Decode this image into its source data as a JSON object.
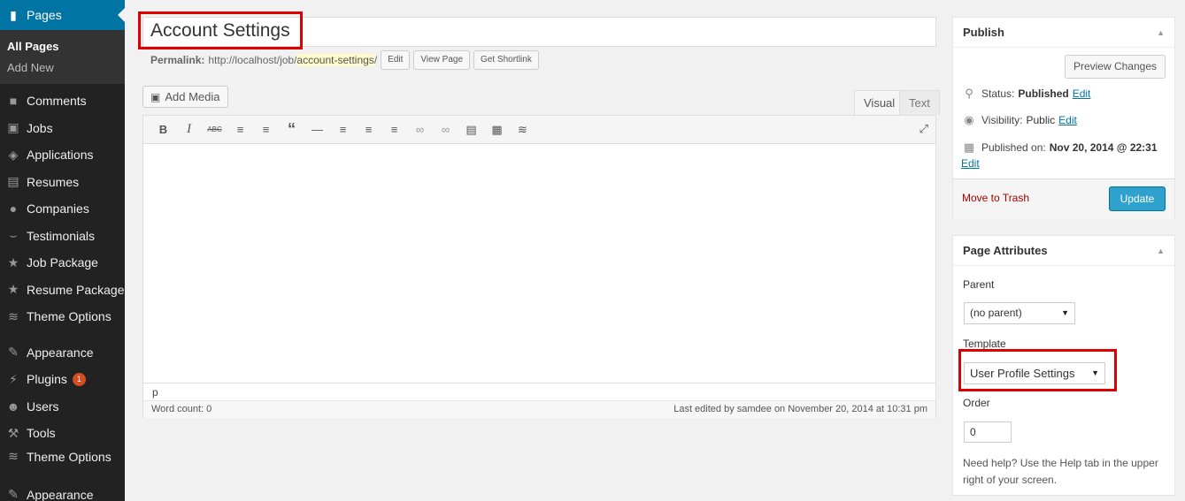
{
  "sidebar": {
    "current": {
      "label": "Pages",
      "icon": "pages-icon"
    },
    "submenu": [
      "All Pages",
      "Add New"
    ],
    "items": [
      {
        "label": "Comments",
        "icon": "comment-icon"
      },
      {
        "label": "Jobs",
        "icon": "folder-icon"
      },
      {
        "label": "Applications",
        "icon": "tag-icon"
      },
      {
        "label": "Resumes",
        "icon": "id-card-icon"
      },
      {
        "label": "Companies",
        "icon": "group-icon"
      },
      {
        "label": "Testimonials",
        "icon": "smile-icon"
      },
      {
        "label": "Job Package",
        "icon": "star-icon"
      },
      {
        "label": "Resume Package",
        "icon": "star-icon"
      },
      {
        "label": "Theme Options",
        "icon": "wave-icon"
      }
    ],
    "items2": [
      {
        "label": "Appearance",
        "icon": "brush-icon"
      },
      {
        "label": "Plugins",
        "icon": "plug-icon",
        "badge": "1"
      },
      {
        "label": "Users",
        "icon": "user-icon"
      },
      {
        "label": "Tools",
        "icon": "wrench-icon"
      },
      {
        "label": "Theme Options",
        "icon": "wave-icon"
      }
    ],
    "items3": [
      {
        "label": "Appearance",
        "icon": "brush-icon"
      }
    ]
  },
  "title": {
    "value": "Account Settings"
  },
  "permalink": {
    "label": "Permalink:",
    "base": "http://localhost/job/",
    "slug": "account-settings",
    "trail": "/",
    "buttons": [
      "Edit",
      "View Page",
      "Get Shortlink"
    ]
  },
  "editor": {
    "add_media": "Add Media",
    "tabs": [
      "Visual",
      "Text"
    ],
    "path": "p",
    "word_count": "Word count: 0",
    "last_edited": "Last edited by samdee on November 20, 2014 at 10:31 pm"
  },
  "publish": {
    "title": "Publish",
    "preview": "Preview Changes",
    "status_label": "Status:",
    "status_value": "Published",
    "visibility_label": "Visibility:",
    "visibility_value": "Public",
    "published_label": "Published on:",
    "published_value": "Nov 20, 2014 @ 22:31",
    "edit": "Edit",
    "trash": "Move to Trash",
    "update": "Update"
  },
  "attributes": {
    "title": "Page Attributes",
    "parent_label": "Parent",
    "parent_value": "(no parent)",
    "template_label": "Template",
    "template_value": "User Profile Settings",
    "order_label": "Order",
    "order_value": "0",
    "help": "Need help? Use the Help tab in the upper right of your screen."
  },
  "colors": {
    "accent": "#0074a2",
    "highlight": "#dd0000",
    "update": "#2ea2cc"
  }
}
